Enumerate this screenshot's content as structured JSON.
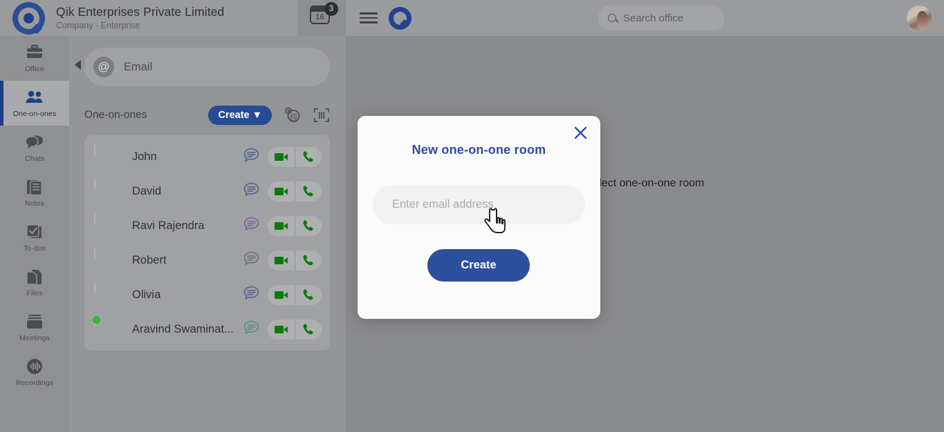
{
  "org": {
    "logo_icon": "qik-logo-icon",
    "name": "Qik Enterprises Private Limited",
    "subtitle": "Company - Enterprise",
    "calendar": {
      "icon": "calendar-icon",
      "day": "16",
      "badge": "3"
    }
  },
  "topbar": {
    "menu_icon": "hamburger-menu-icon",
    "brand_icon": "qik-brand-icon",
    "search": {
      "icon": "search-icon",
      "placeholder": "Search office"
    },
    "avatar_icon": "user-avatar"
  },
  "sidebar": {
    "items": [
      {
        "label": "Office",
        "icon": "briefcase-icon",
        "active": false
      },
      {
        "label": "One-on-ones",
        "icon": "people-icon",
        "active": true
      },
      {
        "label": "Chats",
        "icon": "chat-bubbles-icon",
        "active": false
      },
      {
        "label": "Notes",
        "icon": "notes-icon",
        "active": false
      },
      {
        "label": "To-dos",
        "icon": "checkbox-icon",
        "active": false
      },
      {
        "label": "Files",
        "icon": "files-icon",
        "active": false
      },
      {
        "label": "Meetings",
        "icon": "meetings-icon",
        "active": false
      },
      {
        "label": "Recordings",
        "icon": "recordings-icon",
        "active": false
      }
    ]
  },
  "panel": {
    "collapse_icon": "collapse-left-arrow-icon",
    "email_search": {
      "icon": "at-sign-icon",
      "placeholder": "Email",
      "value": ""
    },
    "title": "One-on-ones",
    "create_button": "Create ▼",
    "add_email_icon": "add-at-sign-icon",
    "scan_icon": "scan-code-icon",
    "contacts": [
      {
        "name": "John",
        "chat_icon": "chat-icon",
        "chat_color": "#4a5f8e",
        "video_icon": "video-camera-icon",
        "call_icon": "phone-icon",
        "online": false,
        "skin": "#3d2b22",
        "shirt": "#1c2535"
      },
      {
        "name": "David",
        "chat_icon": "chat-icon",
        "chat_color": "#4a5f8e",
        "video_icon": "video-camera-icon",
        "call_icon": "phone-icon",
        "online": false,
        "skin": "#c79a78",
        "shirt": "#2b3550"
      },
      {
        "name": "Ravi Rajendra",
        "chat_icon": "chat-icon",
        "chat_color": "#7a5f9e",
        "video_icon": "video-camera-icon",
        "call_icon": "phone-icon",
        "online": false,
        "skin": "#7a4e33",
        "shirt": "#3a4a66"
      },
      {
        "name": "Robert",
        "chat_icon": "chat-icon",
        "chat_color": "#6a6a7e",
        "video_icon": "video-camera-icon",
        "call_icon": "phone-icon",
        "online": false,
        "skin": "#d9a070",
        "shirt": "#8a5a33"
      },
      {
        "name": "Olivia",
        "chat_icon": "chat-icon",
        "chat_color": "#4a5f8e",
        "video_icon": "video-camera-icon",
        "call_icon": "phone-icon",
        "online": false,
        "skin": "#c99a78",
        "shirt": "#33435e"
      },
      {
        "name": "Aravind Swaminat...",
        "chat_icon": "chat-icon",
        "chat_color": "#4e8e86",
        "video_icon": "video-camera-icon",
        "call_icon": "phone-icon",
        "online": true,
        "skin": "#9a6b48",
        "shirt": "#5a6a7a"
      }
    ]
  },
  "main": {
    "empty_message": "Select one-on-one room"
  },
  "modal": {
    "close_icon": "close-icon",
    "title": "New one-on-one room",
    "input": {
      "placeholder": "Enter email address",
      "value": ""
    },
    "create_button": "Create",
    "cursor_icon": "pointing-hand-cursor"
  },
  "colors": {
    "brand_blue": "#1d3f86",
    "modal_blue": "#2c4f9e",
    "call_green": "#0a7a0a",
    "online_green": "#2bbb2b"
  }
}
